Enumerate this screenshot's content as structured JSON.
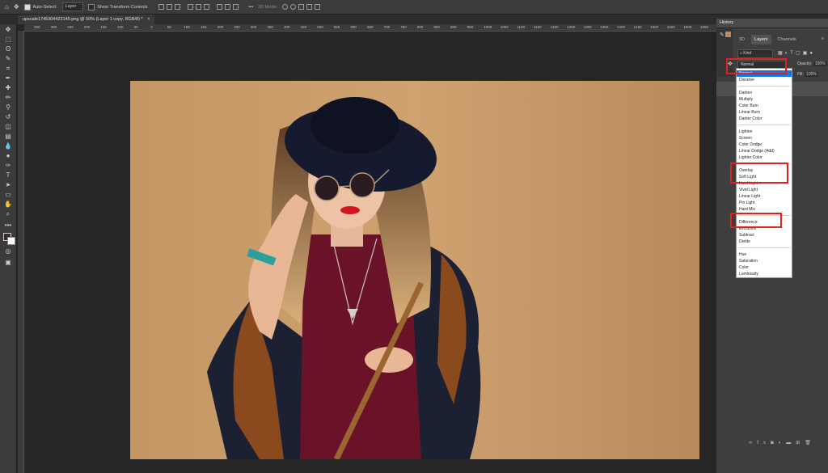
{
  "options_bar": {
    "auto_select_label": "Auto-Select:",
    "auto_select_target": "Layer",
    "show_transform_label": "Show Transform Controls",
    "mode_3d": "3D Mode:"
  },
  "document": {
    "tab_title": "upscale1745304422145.png @ 50% (Layer 1 copy, RGB/8) *"
  },
  "ruler": {
    "ticks": [
      "350",
      "300",
      "250",
      "200",
      "150",
      "100",
      "50",
      "0",
      "50",
      "100",
      "150",
      "200",
      "250",
      "300",
      "350",
      "400",
      "450",
      "500",
      "550",
      "600",
      "650",
      "700",
      "750",
      "800",
      "850",
      "900",
      "950",
      "1000",
      "1050",
      "1100",
      "1150",
      "1200",
      "1250",
      "1300",
      "1350",
      "1400",
      "1450",
      "1500",
      "1550",
      "1600",
      "1650",
      "1700",
      "1750",
      "1800",
      "1850",
      "1900",
      "1950",
      "2000",
      "2050",
      "2100",
      "2150",
      "2200",
      "2250",
      "2300",
      "2350",
      "2400",
      "2450",
      "2500",
      "2550",
      "2600",
      "2650",
      "2700",
      "2750",
      "2800",
      "2850",
      "2900",
      "2950",
      "3000",
      "3050",
      "3100"
    ]
  },
  "panels": {
    "history_title": "History",
    "tabs": [
      "3D",
      "Layers",
      "Channels"
    ],
    "filter_kind": "Kind",
    "blend_mode_value": "Normal",
    "opacity_label": "Opacity:",
    "opacity_value": "100%",
    "fill_label": "Fill:",
    "fill_value": "100%"
  },
  "blend_modes": {
    "groups": [
      [
        "Normal",
        "Dissolve"
      ],
      [
        "Darken",
        "Multiply",
        "Color Burn",
        "Linear Burn",
        "Darker Color"
      ],
      [
        "Lighten",
        "Screen",
        "Color Dodge",
        "Linear Dodge (Add)",
        "Lighter Color"
      ],
      [
        "Overlay",
        "Soft Light",
        "Hard Light",
        "Vivid Light",
        "Linear Light",
        "Pin Light",
        "Hard Mix"
      ],
      [
        "Difference",
        "Exclusion",
        "Subtract",
        "Divide"
      ],
      [
        "Hue",
        "Saturation",
        "Color",
        "Luminosity"
      ]
    ],
    "selected": "Normal",
    "highlighted": [
      "Overlay",
      "Soft Light",
      "Difference"
    ]
  },
  "colors": {
    "accent_selected": "#1473e6",
    "highlight_box": "#e0221f",
    "backdrop": "#c99c6a"
  }
}
